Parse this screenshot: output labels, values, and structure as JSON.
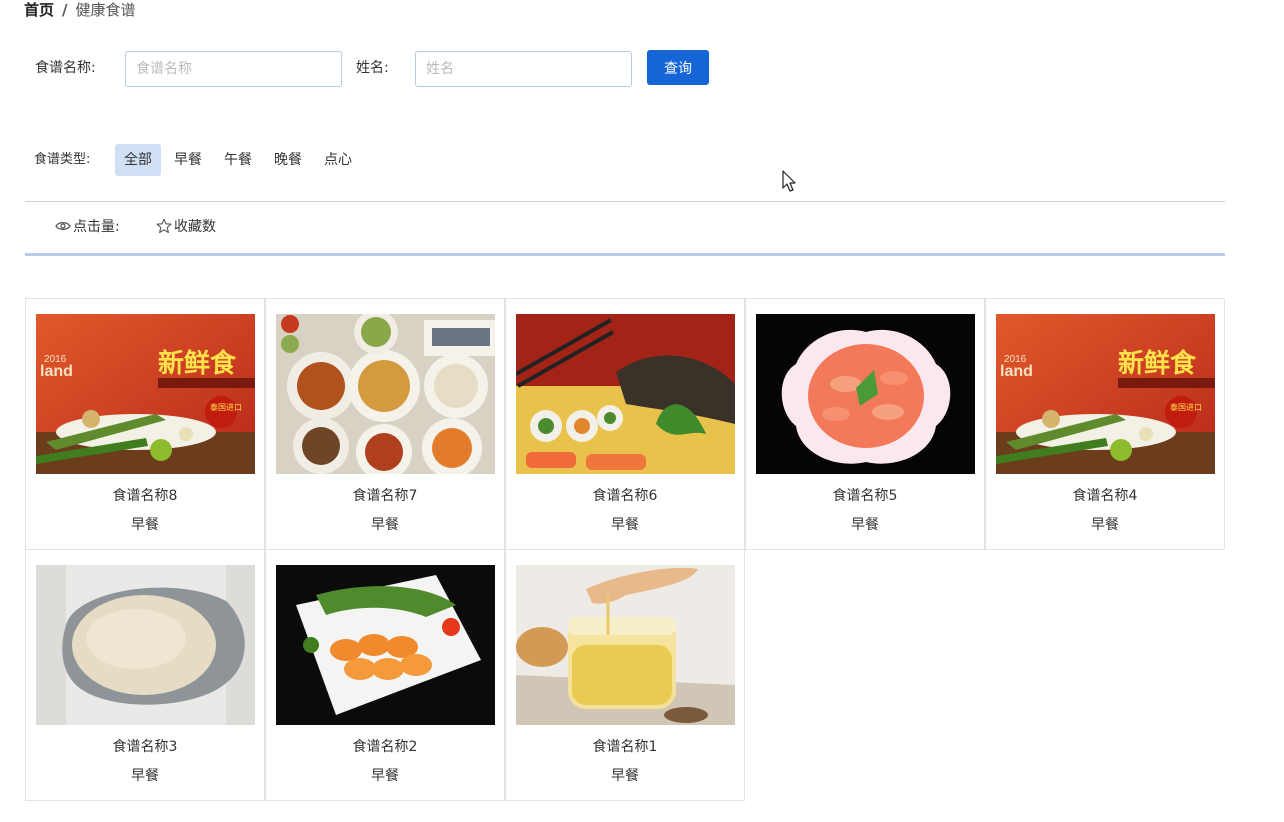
{
  "breadcrumb": {
    "home": "首页",
    "separator": "/",
    "current": "健康食谱"
  },
  "search": {
    "name_label": "食谱名称:",
    "name_placeholder": "食谱名称",
    "name_value": "",
    "person_label": "姓名:",
    "person_placeholder": "姓名",
    "person_value": "",
    "query_button": "查询"
  },
  "filter": {
    "label": "食谱类型:",
    "options": [
      "全部",
      "早餐",
      "午餐",
      "晚餐",
      "点心"
    ],
    "selected": "全部"
  },
  "sort": {
    "clicks_label": "点击量:",
    "favorites_label": "收藏数",
    "icons": [
      "eye-icon",
      "star-outline-icon"
    ]
  },
  "recipes": [
    {
      "name": "食谱名称8",
      "type": "早餐",
      "image": "fresh-food-poster"
    },
    {
      "name": "食谱名称7",
      "type": "早餐",
      "image": "asian-dishes-spread"
    },
    {
      "name": "食谱名称6",
      "type": "早餐",
      "image": "sushi-platter"
    },
    {
      "name": "食谱名称5",
      "type": "早餐",
      "image": "shrimp-bowl"
    },
    {
      "name": "食谱名称4",
      "type": "早餐",
      "image": "fresh-food-poster"
    },
    {
      "name": "食谱名称3",
      "type": "早餐",
      "image": "rice-bowl"
    },
    {
      "name": "食谱名称2",
      "type": "早餐",
      "image": "sliced-egg-roll-plate"
    },
    {
      "name": "食谱名称1",
      "type": "早餐",
      "image": "honey-jar"
    }
  ],
  "poster_text": {
    "brand_year": "2016",
    "brand_word": "land",
    "headline": "新鲜食",
    "badge": "泰国进口"
  },
  "colors": {
    "accent": "#1565d6",
    "active_filter_bg": "#cfe0f5",
    "divider": "#b5cde8",
    "card_border": "#e3e3e3"
  }
}
